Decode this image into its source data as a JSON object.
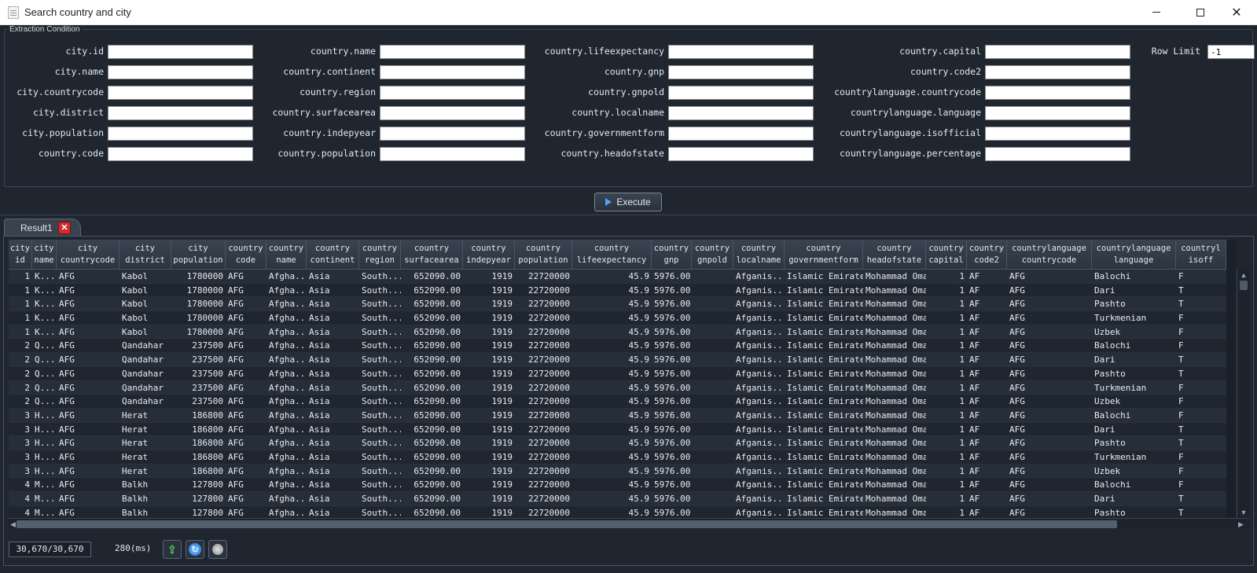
{
  "window": {
    "title": "Search country and city"
  },
  "condition": {
    "legend": "Extraction Condition",
    "row_limit_label": "Row Limit",
    "row_limit_value": "-1",
    "columns": [
      [
        "city.id",
        "city.name",
        "city.countrycode",
        "city.district",
        "city.population",
        "country.code"
      ],
      [
        "country.name",
        "country.continent",
        "country.region",
        "country.surfacearea",
        "country.indepyear",
        "country.population"
      ],
      [
        "country.lifeexpectancy",
        "country.gnp",
        "country.gnpold",
        "country.localname",
        "country.governmentform",
        "country.headofstate"
      ],
      [
        "country.capital",
        "country.code2",
        "countrylanguage.countrycode",
        "countrylanguage.language",
        "countrylanguage.isofficial",
        "countrylanguage.percentage"
      ]
    ]
  },
  "execute_label": "Execute",
  "tab": {
    "label": "Result1"
  },
  "table": {
    "headers": [
      "city\nid",
      "city\nname",
      "city\ncountrycode",
      "city\ndistrict",
      "city\npopulation",
      "country\ncode",
      "country\nname",
      "country\ncontinent",
      "country\nregion",
      "country\nsurfacearea",
      "country\nindepyear",
      "country\npopulation",
      "country\nlifeexpectancy",
      "country\ngnp",
      "country\ngnpold",
      "country\nlocalname",
      "country\ngovernmentform",
      "country\nheadofstate",
      "country\ncapital",
      "country\ncode2",
      "countrylanguage\ncountrycode",
      "countrylanguage\nlanguage",
      "countryl\nisoff"
    ],
    "rows": [
      [
        "1",
        "K...",
        "AFG",
        "Kabol",
        "1780000",
        "AFG",
        "Afgha...",
        "Asia",
        "South...",
        "652090.00",
        "1919",
        "22720000",
        "45.9",
        "5976.00",
        "",
        "Afganis...",
        "Islamic Emirate",
        "Mohammad Omar",
        "1",
        "AF",
        "AFG",
        "Balochi",
        "F"
      ],
      [
        "1",
        "K...",
        "AFG",
        "Kabol",
        "1780000",
        "AFG",
        "Afgha...",
        "Asia",
        "South...",
        "652090.00",
        "1919",
        "22720000",
        "45.9",
        "5976.00",
        "",
        "Afganis...",
        "Islamic Emirate",
        "Mohammad Omar",
        "1",
        "AF",
        "AFG",
        "Dari",
        "T"
      ],
      [
        "1",
        "K...",
        "AFG",
        "Kabol",
        "1780000",
        "AFG",
        "Afgha...",
        "Asia",
        "South...",
        "652090.00",
        "1919",
        "22720000",
        "45.9",
        "5976.00",
        "",
        "Afganis...",
        "Islamic Emirate",
        "Mohammad Omar",
        "1",
        "AF",
        "AFG",
        "Pashto",
        "T"
      ],
      [
        "1",
        "K...",
        "AFG",
        "Kabol",
        "1780000",
        "AFG",
        "Afgha...",
        "Asia",
        "South...",
        "652090.00",
        "1919",
        "22720000",
        "45.9",
        "5976.00",
        "",
        "Afganis...",
        "Islamic Emirate",
        "Mohammad Omar",
        "1",
        "AF",
        "AFG",
        "Turkmenian",
        "F"
      ],
      [
        "1",
        "K...",
        "AFG",
        "Kabol",
        "1780000",
        "AFG",
        "Afgha...",
        "Asia",
        "South...",
        "652090.00",
        "1919",
        "22720000",
        "45.9",
        "5976.00",
        "",
        "Afganis...",
        "Islamic Emirate",
        "Mohammad Omar",
        "1",
        "AF",
        "AFG",
        "Uzbek",
        "F"
      ],
      [
        "2",
        "Q...",
        "AFG",
        "Qandahar",
        "237500",
        "AFG",
        "Afgha...",
        "Asia",
        "South...",
        "652090.00",
        "1919",
        "22720000",
        "45.9",
        "5976.00",
        "",
        "Afganis...",
        "Islamic Emirate",
        "Mohammad Omar",
        "1",
        "AF",
        "AFG",
        "Balochi",
        "F"
      ],
      [
        "2",
        "Q...",
        "AFG",
        "Qandahar",
        "237500",
        "AFG",
        "Afgha...",
        "Asia",
        "South...",
        "652090.00",
        "1919",
        "22720000",
        "45.9",
        "5976.00",
        "",
        "Afganis...",
        "Islamic Emirate",
        "Mohammad Omar",
        "1",
        "AF",
        "AFG",
        "Dari",
        "T"
      ],
      [
        "2",
        "Q...",
        "AFG",
        "Qandahar",
        "237500",
        "AFG",
        "Afgha...",
        "Asia",
        "South...",
        "652090.00",
        "1919",
        "22720000",
        "45.9",
        "5976.00",
        "",
        "Afganis...",
        "Islamic Emirate",
        "Mohammad Omar",
        "1",
        "AF",
        "AFG",
        "Pashto",
        "T"
      ],
      [
        "2",
        "Q...",
        "AFG",
        "Qandahar",
        "237500",
        "AFG",
        "Afgha...",
        "Asia",
        "South...",
        "652090.00",
        "1919",
        "22720000",
        "45.9",
        "5976.00",
        "",
        "Afganis...",
        "Islamic Emirate",
        "Mohammad Omar",
        "1",
        "AF",
        "AFG",
        "Turkmenian",
        "F"
      ],
      [
        "2",
        "Q...",
        "AFG",
        "Qandahar",
        "237500",
        "AFG",
        "Afgha...",
        "Asia",
        "South...",
        "652090.00",
        "1919",
        "22720000",
        "45.9",
        "5976.00",
        "",
        "Afganis...",
        "Islamic Emirate",
        "Mohammad Omar",
        "1",
        "AF",
        "AFG",
        "Uzbek",
        "F"
      ],
      [
        "3",
        "H...",
        "AFG",
        "Herat",
        "186800",
        "AFG",
        "Afgha...",
        "Asia",
        "South...",
        "652090.00",
        "1919",
        "22720000",
        "45.9",
        "5976.00",
        "",
        "Afganis...",
        "Islamic Emirate",
        "Mohammad Omar",
        "1",
        "AF",
        "AFG",
        "Balochi",
        "F"
      ],
      [
        "3",
        "H...",
        "AFG",
        "Herat",
        "186800",
        "AFG",
        "Afgha...",
        "Asia",
        "South...",
        "652090.00",
        "1919",
        "22720000",
        "45.9",
        "5976.00",
        "",
        "Afganis...",
        "Islamic Emirate",
        "Mohammad Omar",
        "1",
        "AF",
        "AFG",
        "Dari",
        "T"
      ],
      [
        "3",
        "H...",
        "AFG",
        "Herat",
        "186800",
        "AFG",
        "Afgha...",
        "Asia",
        "South...",
        "652090.00",
        "1919",
        "22720000",
        "45.9",
        "5976.00",
        "",
        "Afganis...",
        "Islamic Emirate",
        "Mohammad Omar",
        "1",
        "AF",
        "AFG",
        "Pashto",
        "T"
      ],
      [
        "3",
        "H...",
        "AFG",
        "Herat",
        "186800",
        "AFG",
        "Afgha...",
        "Asia",
        "South...",
        "652090.00",
        "1919",
        "22720000",
        "45.9",
        "5976.00",
        "",
        "Afganis...",
        "Islamic Emirate",
        "Mohammad Omar",
        "1",
        "AF",
        "AFG",
        "Turkmenian",
        "F"
      ],
      [
        "3",
        "H...",
        "AFG",
        "Herat",
        "186800",
        "AFG",
        "Afgha...",
        "Asia",
        "South...",
        "652090.00",
        "1919",
        "22720000",
        "45.9",
        "5976.00",
        "",
        "Afganis...",
        "Islamic Emirate",
        "Mohammad Omar",
        "1",
        "AF",
        "AFG",
        "Uzbek",
        "F"
      ],
      [
        "4",
        "M...",
        "AFG",
        "Balkh",
        "127800",
        "AFG",
        "Afgha...",
        "Asia",
        "South...",
        "652090.00",
        "1919",
        "22720000",
        "45.9",
        "5976.00",
        "",
        "Afganis...",
        "Islamic Emirate",
        "Mohammad Omar",
        "1",
        "AF",
        "AFG",
        "Balochi",
        "F"
      ],
      [
        "4",
        "M...",
        "AFG",
        "Balkh",
        "127800",
        "AFG",
        "Afgha...",
        "Asia",
        "South...",
        "652090.00",
        "1919",
        "22720000",
        "45.9",
        "5976.00",
        "",
        "Afganis...",
        "Islamic Emirate",
        "Mohammad Omar",
        "1",
        "AF",
        "AFG",
        "Dari",
        "T"
      ],
      [
        "4",
        "M...",
        "AFG",
        "Balkh",
        "127800",
        "AFG",
        "Afgha...",
        "Asia",
        "South...",
        "652090.00",
        "1919",
        "22720000",
        "45.9",
        "5976.00",
        "",
        "Afganis...",
        "Islamic Emirate",
        "Mohammad Omar",
        "1",
        "AF",
        "AFG",
        "Pashto",
        "T"
      ]
    ]
  },
  "status": {
    "count": "30,670/30,670",
    "elapsed": "280(ms)"
  },
  "icons": {
    "export": "export-icon",
    "refresh": "refresh-icon",
    "stop": "stop-icon"
  },
  "colors": {
    "background": "#1f2630",
    "accent": "#4da3ff",
    "tab_close": "#d42a2a"
  }
}
